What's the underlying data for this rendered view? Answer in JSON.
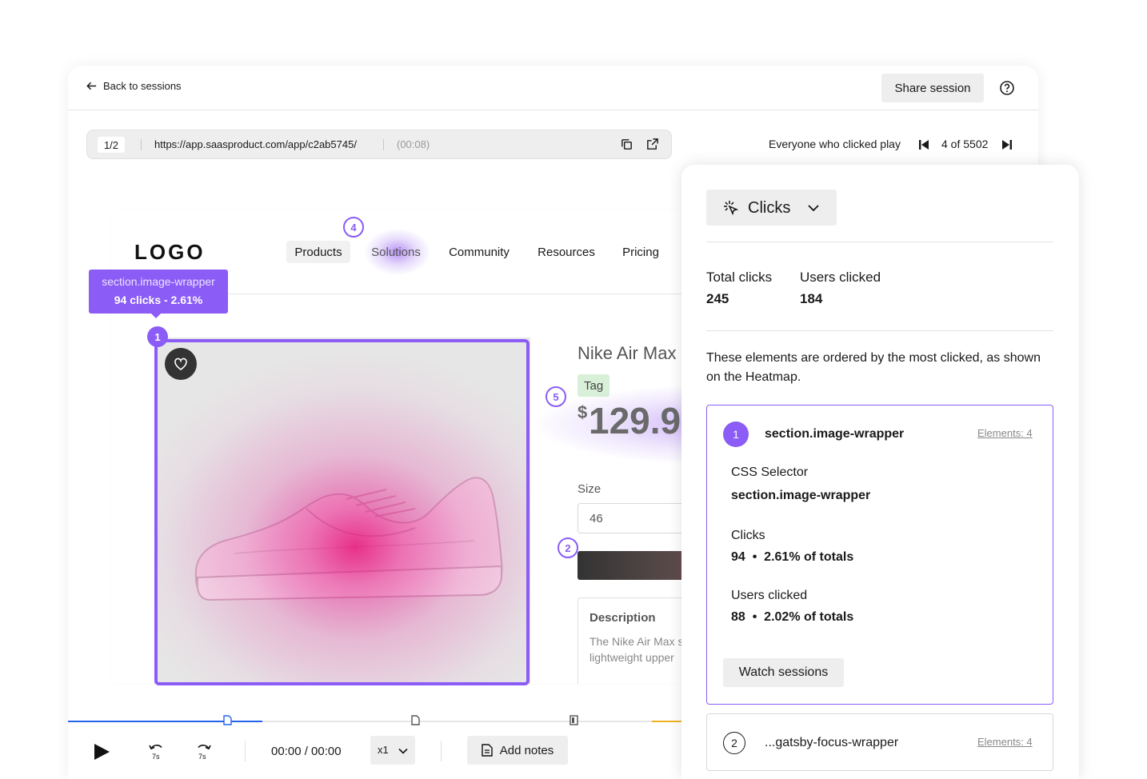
{
  "header": {
    "back_label": "Back to sessions",
    "share_label": "Share session"
  },
  "urlbar": {
    "page_indicator": "1/2",
    "url": "https://app.saasproduct.com/app/c2ab5745/",
    "time": "(00:08)"
  },
  "session_nav": {
    "filter_label": "Everyone who clicked play",
    "count": "4 of 5502"
  },
  "site": {
    "logo": "LOGO",
    "nav": [
      "Products",
      "Solutions",
      "Community",
      "Resources",
      "Pricing"
    ],
    "product_title": "Nike Air Max",
    "tag": "Tag",
    "price_symbol": "$",
    "price": "129.9",
    "size_label": "Size",
    "size_value": "46",
    "description_title": "Description",
    "description_text": "The Nike Air Max stylish, modern design, lightweight upper"
  },
  "overlay": {
    "tooltip_selector": "section.image-wrapper",
    "tooltip_stats": "94 clicks - 2.61%",
    "markers": [
      "1",
      "2",
      "4",
      "5"
    ]
  },
  "player": {
    "time": "00:00 / 00:00",
    "speed": "x1",
    "notes_label": "Add notes",
    "rewind_label": "7s",
    "forward_label": "7s"
  },
  "panel": {
    "mode": "Clicks",
    "total_clicks_label": "Total clicks",
    "total_clicks": "245",
    "users_clicked_label": "Users clicked",
    "users_clicked": "184",
    "description": "These elements are ordered by the most clicked, as shown on the Heatmap.",
    "elements": [
      {
        "rank": "1",
        "name": "section.image-wrapper",
        "elements_link": "Elements: 4",
        "css_label": "CSS Selector",
        "css_value": "section.image-wrapper",
        "clicks_label": "Clicks",
        "clicks_value": "94  •  2.61% of totals",
        "users_label": "Users clicked",
        "users_value": "88  •  2.02% of totals",
        "watch_label": "Watch sessions"
      },
      {
        "rank": "2",
        "name": "...gatsby-focus-wrapper",
        "elements_link": "Elements: 4"
      }
    ]
  },
  "colors": {
    "accent": "#8b5cf6",
    "progress": "#2563eb",
    "heat": "#e61478"
  }
}
